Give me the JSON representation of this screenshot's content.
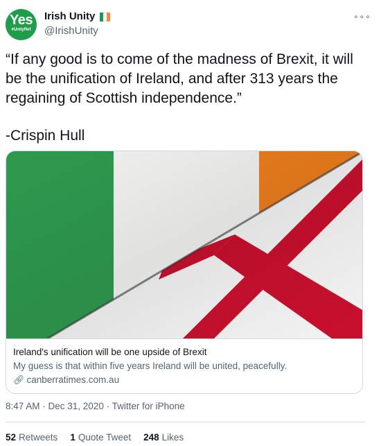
{
  "account": {
    "avatar_text": "Yes",
    "avatar_tag": "#UnityRef",
    "name": "Irish Unity",
    "handle": "@IrishUnity",
    "flag_icon": "ireland-flag-icon"
  },
  "menu_icon": "more-options-icon",
  "tweet": {
    "text": "“If any good is to come of the madness of Brexit, it will be the unification of Ireland, and after 313 years the regaining of Scottish independence.”",
    "author_line": "-Crispin Hull"
  },
  "card": {
    "image_description_icon": "ireland-northern-ireland-flags-image",
    "title": "Ireland's unification will be one upside of Brexit",
    "description": "My guess is that within five years Ireland will be united, peacefully.",
    "domain": "canberratimes.com.au"
  },
  "meta": {
    "time": "8:47 AM",
    "date": "Dec 31, 2020",
    "source": "Twitter for iPhone",
    "timestamp_line": "8:47 AM · Dec 31, 2020 · Twitter for iPhone"
  },
  "stats": {
    "retweets_count": "52",
    "retweets_label": "Retweets",
    "quotes_count": "1",
    "quotes_label": "Quote Tweet",
    "likes_count": "248",
    "likes_label": "Likes"
  },
  "colors": {
    "green": "#169b62",
    "orange": "#ff883e",
    "red": "#c8102e",
    "accent": "#1d9bf0"
  }
}
